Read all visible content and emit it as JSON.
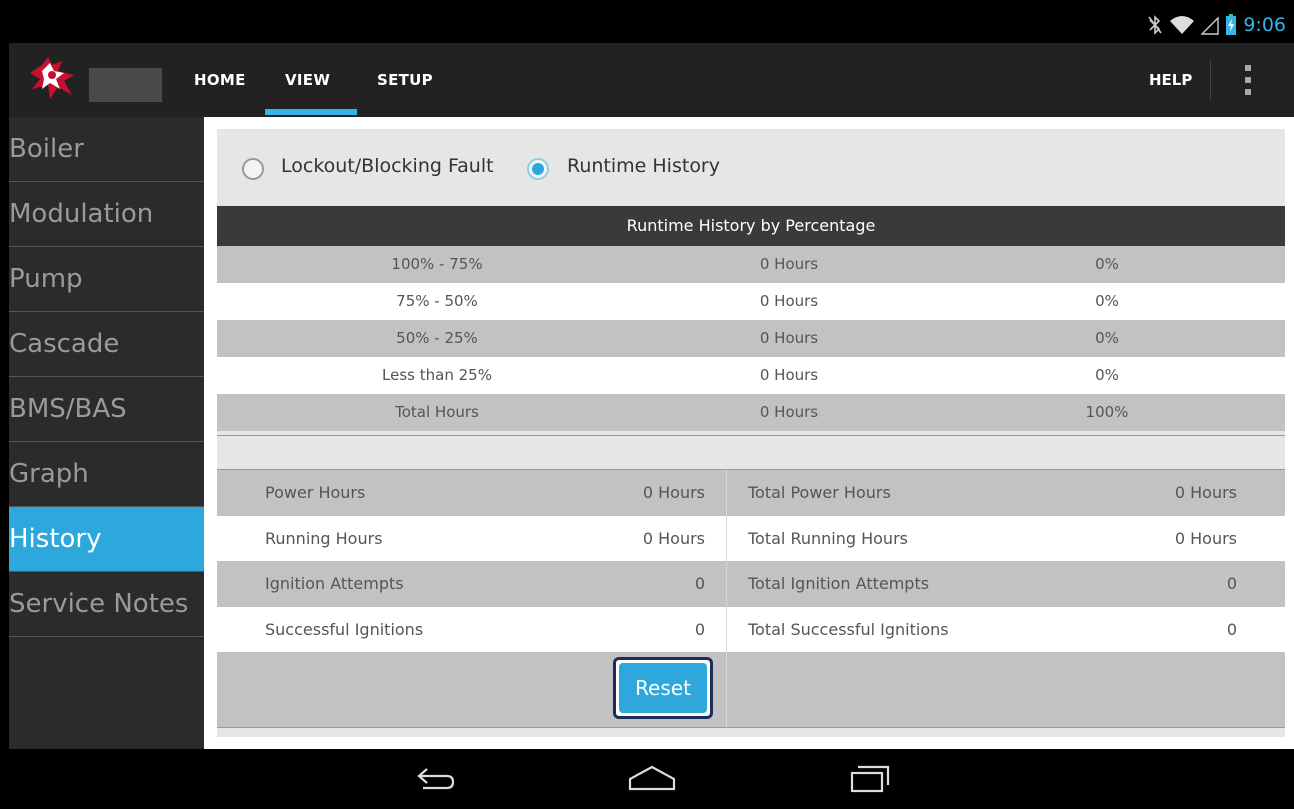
{
  "status": {
    "time": "9:06"
  },
  "actionbar": {
    "tabs": [
      {
        "label": "HOME"
      },
      {
        "label": "VIEW",
        "selected": true
      },
      {
        "label": "SETUP"
      }
    ],
    "help_label": "HELP"
  },
  "sidebar": {
    "items": [
      {
        "label": "Boiler"
      },
      {
        "label": "Modulation"
      },
      {
        "label": "Pump"
      },
      {
        "label": "Cascade"
      },
      {
        "label": "BMS/BAS"
      },
      {
        "label": "Graph"
      },
      {
        "label": "History",
        "active": true
      },
      {
        "label": "Service Notes"
      }
    ]
  },
  "mode": {
    "options": [
      {
        "label": "Lockout/Blocking Fault",
        "selected": false
      },
      {
        "label": "Runtime History",
        "selected": true
      }
    ]
  },
  "runtime": {
    "title": "Runtime History by Percentage",
    "rows": [
      {
        "range": "100% - 75%",
        "hours": "0 Hours",
        "percent": "0%"
      },
      {
        "range": "75% - 50%",
        "hours": "0 Hours",
        "percent": "0%"
      },
      {
        "range": "50% - 25%",
        "hours": "0 Hours",
        "percent": "0%"
      },
      {
        "range": "Less than 25%",
        "hours": "0 Hours",
        "percent": "0%"
      },
      {
        "range": "Total Hours",
        "hours": "0 Hours",
        "percent": "100%"
      }
    ]
  },
  "stats": {
    "rows": [
      {
        "label": "Power Hours",
        "value": "0 Hours",
        "total_label": "Total Power Hours",
        "total_value": "0 Hours"
      },
      {
        "label": "Running Hours",
        "value": "0 Hours",
        "total_label": "Total Running Hours",
        "total_value": "0 Hours"
      },
      {
        "label": "Ignition Attempts",
        "value": "0",
        "total_label": "Total Ignition Attempts",
        "total_value": "0"
      },
      {
        "label": "Successful Ignitions",
        "value": "0",
        "total_label": "Total Successful Ignitions",
        "total_value": "0"
      }
    ],
    "reset_label": "Reset"
  },
  "colors": {
    "accent": "#33b5e5",
    "active_bg": "#2ea7dd"
  }
}
